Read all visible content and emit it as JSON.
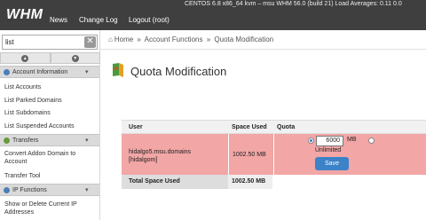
{
  "header": {
    "logo": "WHM",
    "nav": [
      "News",
      "Change Log",
      "Logout (root)"
    ],
    "sysinfo": "CENTOS 6.8 x86_64 kvm – msu     WHM 56.0 (build 21)     Load Averages: 0.11 0.0"
  },
  "sidebar": {
    "search_value": "list",
    "clear_label": "✕",
    "categories": [
      {
        "label": "Account Information",
        "icon_color": "#4a7fb8",
        "items": [
          "List Accounts",
          "List Parked Domains",
          "List Subdomains",
          "List Suspended Accounts"
        ]
      },
      {
        "label": "Transfers",
        "icon_color": "#6a9a3a",
        "items": [
          "Convert Addon Domain to Account",
          "Transfer Tool"
        ]
      },
      {
        "label": "IP Functions",
        "icon_color": "#4a7fb8",
        "items": [
          "Show or Delete Current IP Addresses"
        ]
      }
    ]
  },
  "breadcrumb": {
    "home": "Home",
    "sep": "»",
    "section": "Account Functions",
    "current": "Quota Modification"
  },
  "page": {
    "title": "Quota Modification"
  },
  "table": {
    "headers": {
      "user": "User",
      "space": "Space Used",
      "quota": "Quota"
    },
    "row": {
      "user_line1": "hidalgo5.msu.domains",
      "user_line2": "[hidalgom]",
      "space_used": "1002.50 MB",
      "quota_value": "6000",
      "unit": "MB",
      "unlimited": "Unlimited",
      "save": "Save"
    },
    "total": {
      "label": "Total Space Used",
      "value": "1002.50 MB"
    }
  },
  "colors": {
    "topbar": "#3f3f3f",
    "row_highlight": "#f2a6a6",
    "accent": "#3c82c8"
  }
}
